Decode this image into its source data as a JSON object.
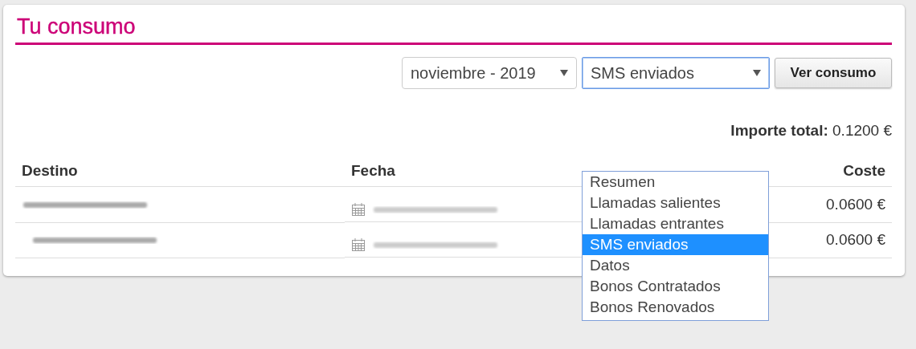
{
  "title": "Tu consumo",
  "filters": {
    "month_select": {
      "value": "noviembre - 2019"
    },
    "type_select": {
      "value": "SMS enviados",
      "expanded": true,
      "options": [
        {
          "label": "Resumen",
          "selected": false
        },
        {
          "label": "Llamadas salientes",
          "selected": false
        },
        {
          "label": "Llamadas entrantes",
          "selected": false
        },
        {
          "label": "SMS enviados",
          "selected": true
        },
        {
          "label": "Datos",
          "selected": false
        },
        {
          "label": "Bonos Contratados",
          "selected": false
        },
        {
          "label": "Bonos Renovados",
          "selected": false
        }
      ]
    },
    "button": "Ver consumo"
  },
  "total": {
    "label": "Importe total:",
    "value": "0.1200 €"
  },
  "table": {
    "columns": [
      "Destino",
      "Fecha",
      "Coste"
    ],
    "rows": [
      {
        "coste": "0.0600 €"
      },
      {
        "coste": "0.0600 €"
      }
    ]
  }
}
